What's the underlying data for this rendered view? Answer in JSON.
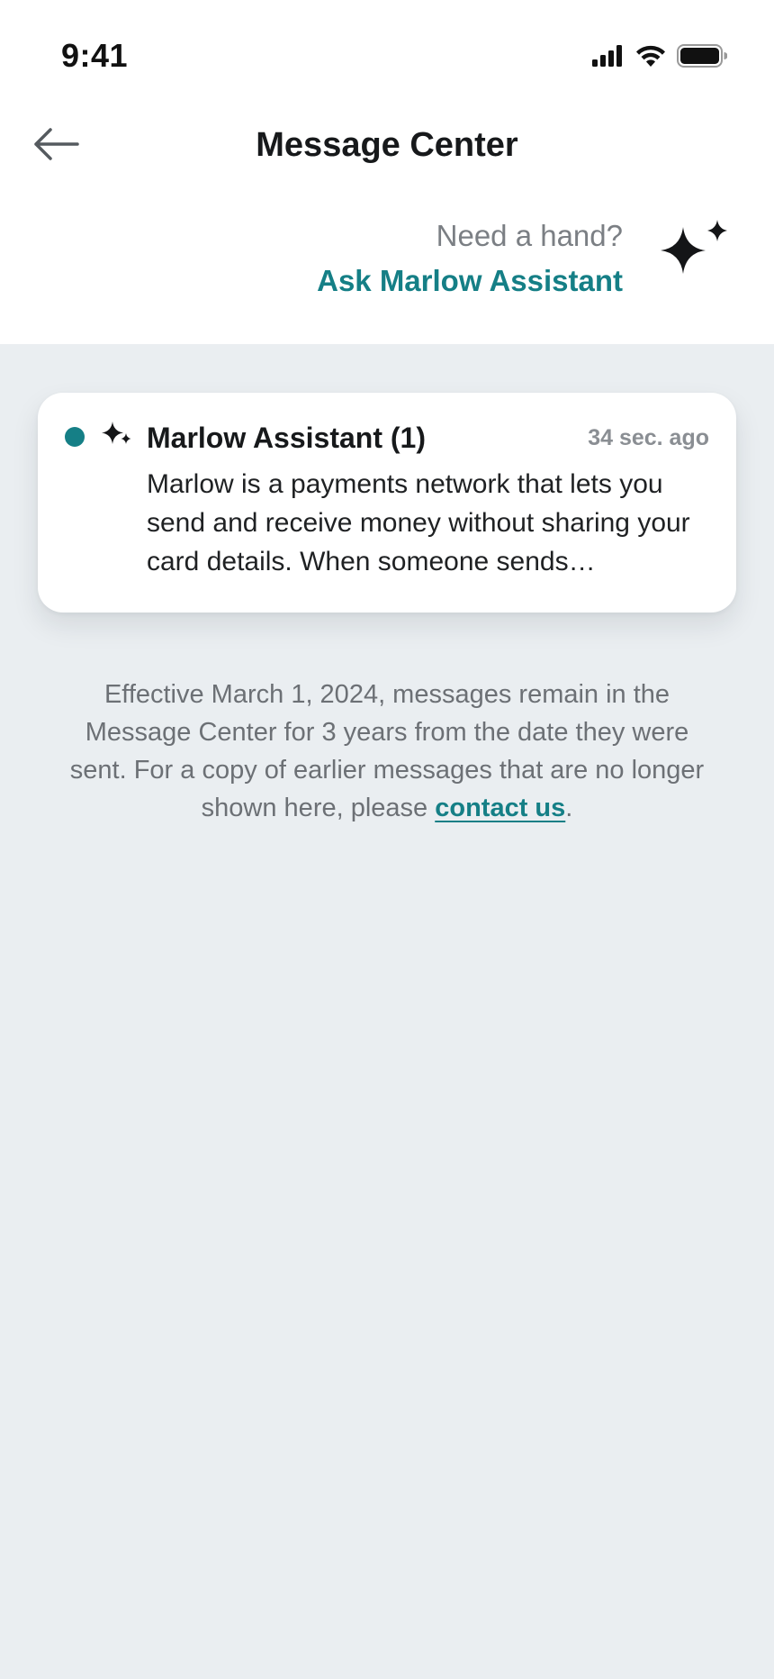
{
  "status_bar": {
    "time": "9:41"
  },
  "header": {
    "title": "Message Center",
    "back_icon": "arrow-left-icon"
  },
  "help": {
    "prompt": "Need a hand?",
    "link_label": "Ask Marlow Assistant",
    "icon": "sparkle-icon"
  },
  "messages": [
    {
      "sender": "Marlow Assistant (1)",
      "time": "34 sec. ago",
      "preview": "Marlow is a payments network that lets you send and receive money without sharing your card details. When someone sends…",
      "unread": true,
      "icon": "sparkle-icon"
    }
  ],
  "notice": {
    "text": "Effective March 1, 2024, messages remain in the Message Center for 3 years from the date they were sent. For a copy of earlier messages that are no longer shown here, please ",
    "link_label": "contact us",
    "suffix": "."
  },
  "colors": {
    "accent": "#157f86",
    "background": "#eaeef1",
    "surface": "#ffffff",
    "muted_text": "#6c7075"
  }
}
